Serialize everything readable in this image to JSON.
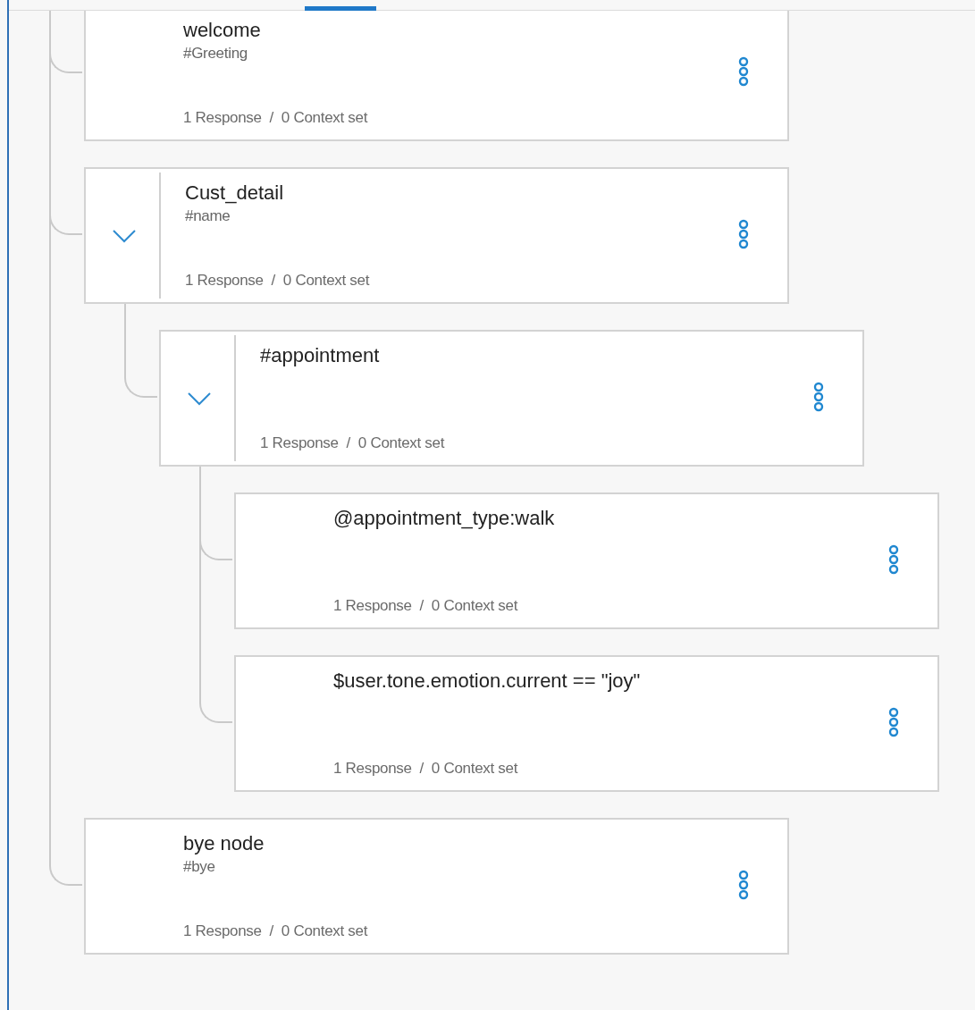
{
  "nodes": [
    {
      "title": "welcome",
      "condition": "#Greeting",
      "summary": "1 Response  /  0 Context set"
    },
    {
      "title": "Cust_detail",
      "condition": "#name",
      "summary": "1 Response  /  0 Context set",
      "expanded": true,
      "children": [
        {
          "title": "#appointment",
          "summary": "1 Response  /  0 Context set",
          "expanded": true,
          "children": [
            {
              "title": "@appointment_type:walk",
              "summary": "1 Response  /  0 Context set"
            },
            {
              "title": "$user.tone.emotion.current == \"joy\"",
              "summary": "1 Response  /  0 Context set"
            }
          ]
        }
      ]
    },
    {
      "title": "bye node",
      "condition": "#bye",
      "summary": "1 Response  /  0 Context set"
    }
  ]
}
